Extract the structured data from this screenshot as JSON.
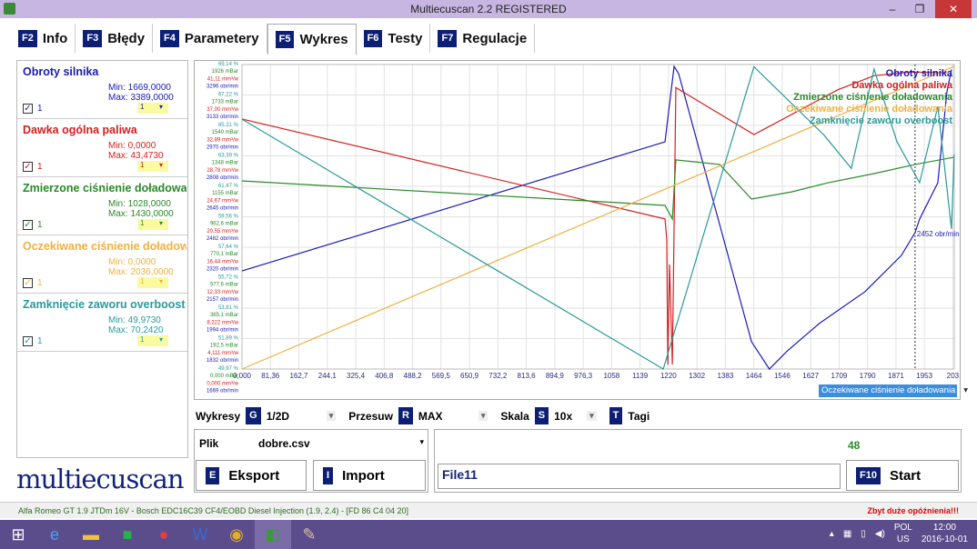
{
  "window": {
    "title": "Multiecuscan 2.2 REGISTERED",
    "min": "‒",
    "restore": "❐",
    "close": "✕"
  },
  "tabs": [
    {
      "key": "F2",
      "label": "Info"
    },
    {
      "key": "F3",
      "label": "Błędy"
    },
    {
      "key": "F4",
      "label": "Parametery"
    },
    {
      "key": "F5",
      "label": "Wykres",
      "active": true
    },
    {
      "key": "F6",
      "label": "Testy"
    },
    {
      "key": "F7",
      "label": "Regulacje"
    }
  ],
  "signals": [
    {
      "name": "Obroty silnika",
      "min": "Min: 1669,0000",
      "max": "Max: 3389,0000",
      "checked": "✓",
      "scale_label": "1",
      "sel": "1",
      "color": "#1a1ab8"
    },
    {
      "name": "Dawka ogólna paliwa",
      "min": "Min: 0,0000",
      "max": "Max: 43,4730",
      "checked": "✓",
      "scale_label": "1",
      "sel": "1",
      "color": "#d42020"
    },
    {
      "name": "Zmierzone ciśnienie doładowani",
      "min": "Min: 1028,0000",
      "max": "Max: 1430,0000",
      "checked": "✓",
      "scale_label": "1",
      "sel": "1",
      "color": "#2a8a2a"
    },
    {
      "name": "Oczekiwane ciśnienie doładowai",
      "min": "Min: 0,0000",
      "max": "Max: 2036,0000",
      "checked": "✓",
      "scale_label": "1",
      "sel": "1",
      "color": "#f0b040"
    },
    {
      "name": "Zamknięcie zaworu overboost",
      "min": "Min: 49,9730",
      "max": "Max: 70,2420",
      "checked": "✓",
      "scale_label": "1",
      "sel": "1",
      "color": "#2a9a9a"
    }
  ],
  "logo": "multiecuscan",
  "chart_data": {
    "type": "line",
    "xlim": [
      0,
      2034
    ],
    "x_ticks": [
      "0,000",
      "81,36",
      "162,7",
      "244,1",
      "325,4",
      "406,8",
      "488,2",
      "569,5",
      "650,9",
      "732,2",
      "813,6",
      "894,9",
      "976,3",
      "1058",
      "1139",
      "1220",
      "1302",
      "1383",
      "1464",
      "1546",
      "1627",
      "1709",
      "1790",
      "1871",
      "1953",
      "203"
    ],
    "y_ticks": [
      [
        "69,14 %",
        "1926 mBar",
        "41,11 mm³/w",
        "3296 obr/min"
      ],
      [
        "67,22 %",
        "1733 mBar",
        "37,00 mm³/w",
        "3133 obr/min"
      ],
      [
        "65,31 %",
        "1540 mBar",
        "32,89 mm³/w",
        "2970 obr/min"
      ],
      [
        "63,39 %",
        "1348 mBar",
        "28,78 mm³/w",
        "2808 obr/min"
      ],
      [
        "61,47 %",
        "1155 mBar",
        "24,67 mm³/w",
        "2645 obr/min"
      ],
      [
        "59,56 %",
        "962,6 mBar",
        "20,55 mm³/w",
        "2482 obr/min"
      ],
      [
        "57,64 %",
        "770,1 mBar",
        "16,44 mm³/w",
        "2320 obr/min"
      ],
      [
        "55,72 %",
        "577,6 mBar",
        "12,33 mm³/w",
        "2157 obr/min"
      ],
      [
        "53,81 %",
        "385,1 mBar",
        "8,222 mm³/w",
        "1994 obr/min"
      ],
      [
        "51,89 %",
        "192,5 mBar",
        "4,111 mm³/w",
        "1832 obr/min"
      ],
      [
        "49,97 %",
        "0,000 mBar",
        "0,000 mm³/w",
        "1669 obr/min"
      ]
    ],
    "y_tick_colors": [
      "#2a9a9a",
      "#2a8a2a",
      "#d42020",
      "#1a1ab8"
    ],
    "series": [
      {
        "name": "Obroty silnika",
        "color": "#1a1ab8",
        "ylim": [
          1669,
          3296
        ],
        "x": [
          0,
          1208,
          1234,
          1247,
          1455,
          1506,
          1558,
          1649,
          1779,
          1883,
          1922,
          1935,
          1987,
          2000,
          2013,
          2026
        ],
        "y": [
          2193,
          2883,
          3286,
          3247,
          1815,
          1669,
          1767,
          1913,
          2082,
          2276,
          2398,
          2470,
          2664,
          2907,
          3150,
          3270
        ]
      },
      {
        "name": "Dawka ogólna paliwa",
        "color": "#d42020",
        "ylim": [
          0,
          41.11
        ],
        "x": [
          0,
          1208,
          1213,
          1216,
          1221,
          1229,
          1239,
          1462,
          1571,
          1701,
          1805,
          1909,
          2013
        ],
        "y": [
          33.75,
          20.26,
          17.55,
          0.6,
          14.1,
          0.6,
          38.0,
          31.66,
          34.4,
          37.7,
          39.6,
          40.1,
          40.0
        ]
      },
      {
        "name": "Zmierzone ciśnienie doładowania",
        "color": "#2a8a2a",
        "ylim": [
          0,
          1926
        ],
        "x": [
          0,
          1208,
          1229,
          1239,
          1364,
          1455,
          1571,
          1675,
          1805,
          1922,
          2034
        ],
        "y": [
          1190,
          1035,
          949,
          1323,
          1294,
          1075,
          1121,
          1179,
          1236,
          1294,
          1340
        ]
      },
      {
        "name": "Oczekiwane ciśnienie doładowania",
        "color": "#f0b040",
        "ylim": [
          0,
          1926
        ],
        "x": [
          0,
          2034
        ],
        "y": [
          0,
          1915
        ]
      },
      {
        "name": "Zamknięcie zaworu overboost",
        "color": "#2a9a9a",
        "ylim": [
          49.97,
          69.14
        ],
        "x": [
          0,
          1203,
          1462,
          1662,
          1740,
          1805,
          1870,
          1935,
          1987,
          2026,
          2034
        ],
        "y": [
          65.7,
          49.97,
          69.0,
          64.7,
          62.6,
          68.85,
          64.3,
          61.7,
          66.5,
          58.8,
          63.5
        ]
      }
    ],
    "cursor": {
      "x": 1922,
      "label": "2452 obr/min"
    },
    "axis_select": "Oczekiwane ciśnienie doładowania"
  },
  "controls": {
    "wykresy_label": "Wykresy",
    "wykresy_key": "G",
    "wykresy_value": "1/2D",
    "przesuw_label": "Przesuw",
    "przesuw_key": "R",
    "przesuw_value": "MAX",
    "skala_label": "Skala",
    "skala_key": "S",
    "skala_value": "10x",
    "tagi_key": "T",
    "tagi_label": "Tagi",
    "dd": "▾"
  },
  "file": {
    "label": "Plik",
    "value": "dobre.csv",
    "export_key": "E",
    "export_label": "Eksport",
    "import_key": "I",
    "import_label": "Import"
  },
  "record": {
    "count": "48",
    "filename": "File11",
    "start_key": "F10",
    "start_label": "Start"
  },
  "status": {
    "vehicle": "Alfa Romeo GT 1.9 JTDm 16V - Bosch EDC16C39 CF4/EOBD Diesel Injection (1.9, 2.4) - [FD 86 C4 04 20]",
    "warning": "Zbyt duże opóźnienia!!!"
  },
  "taskbar": {
    "lang1": "POL",
    "lang2": "US",
    "time": "12:00",
    "date": "2016-10-01"
  }
}
